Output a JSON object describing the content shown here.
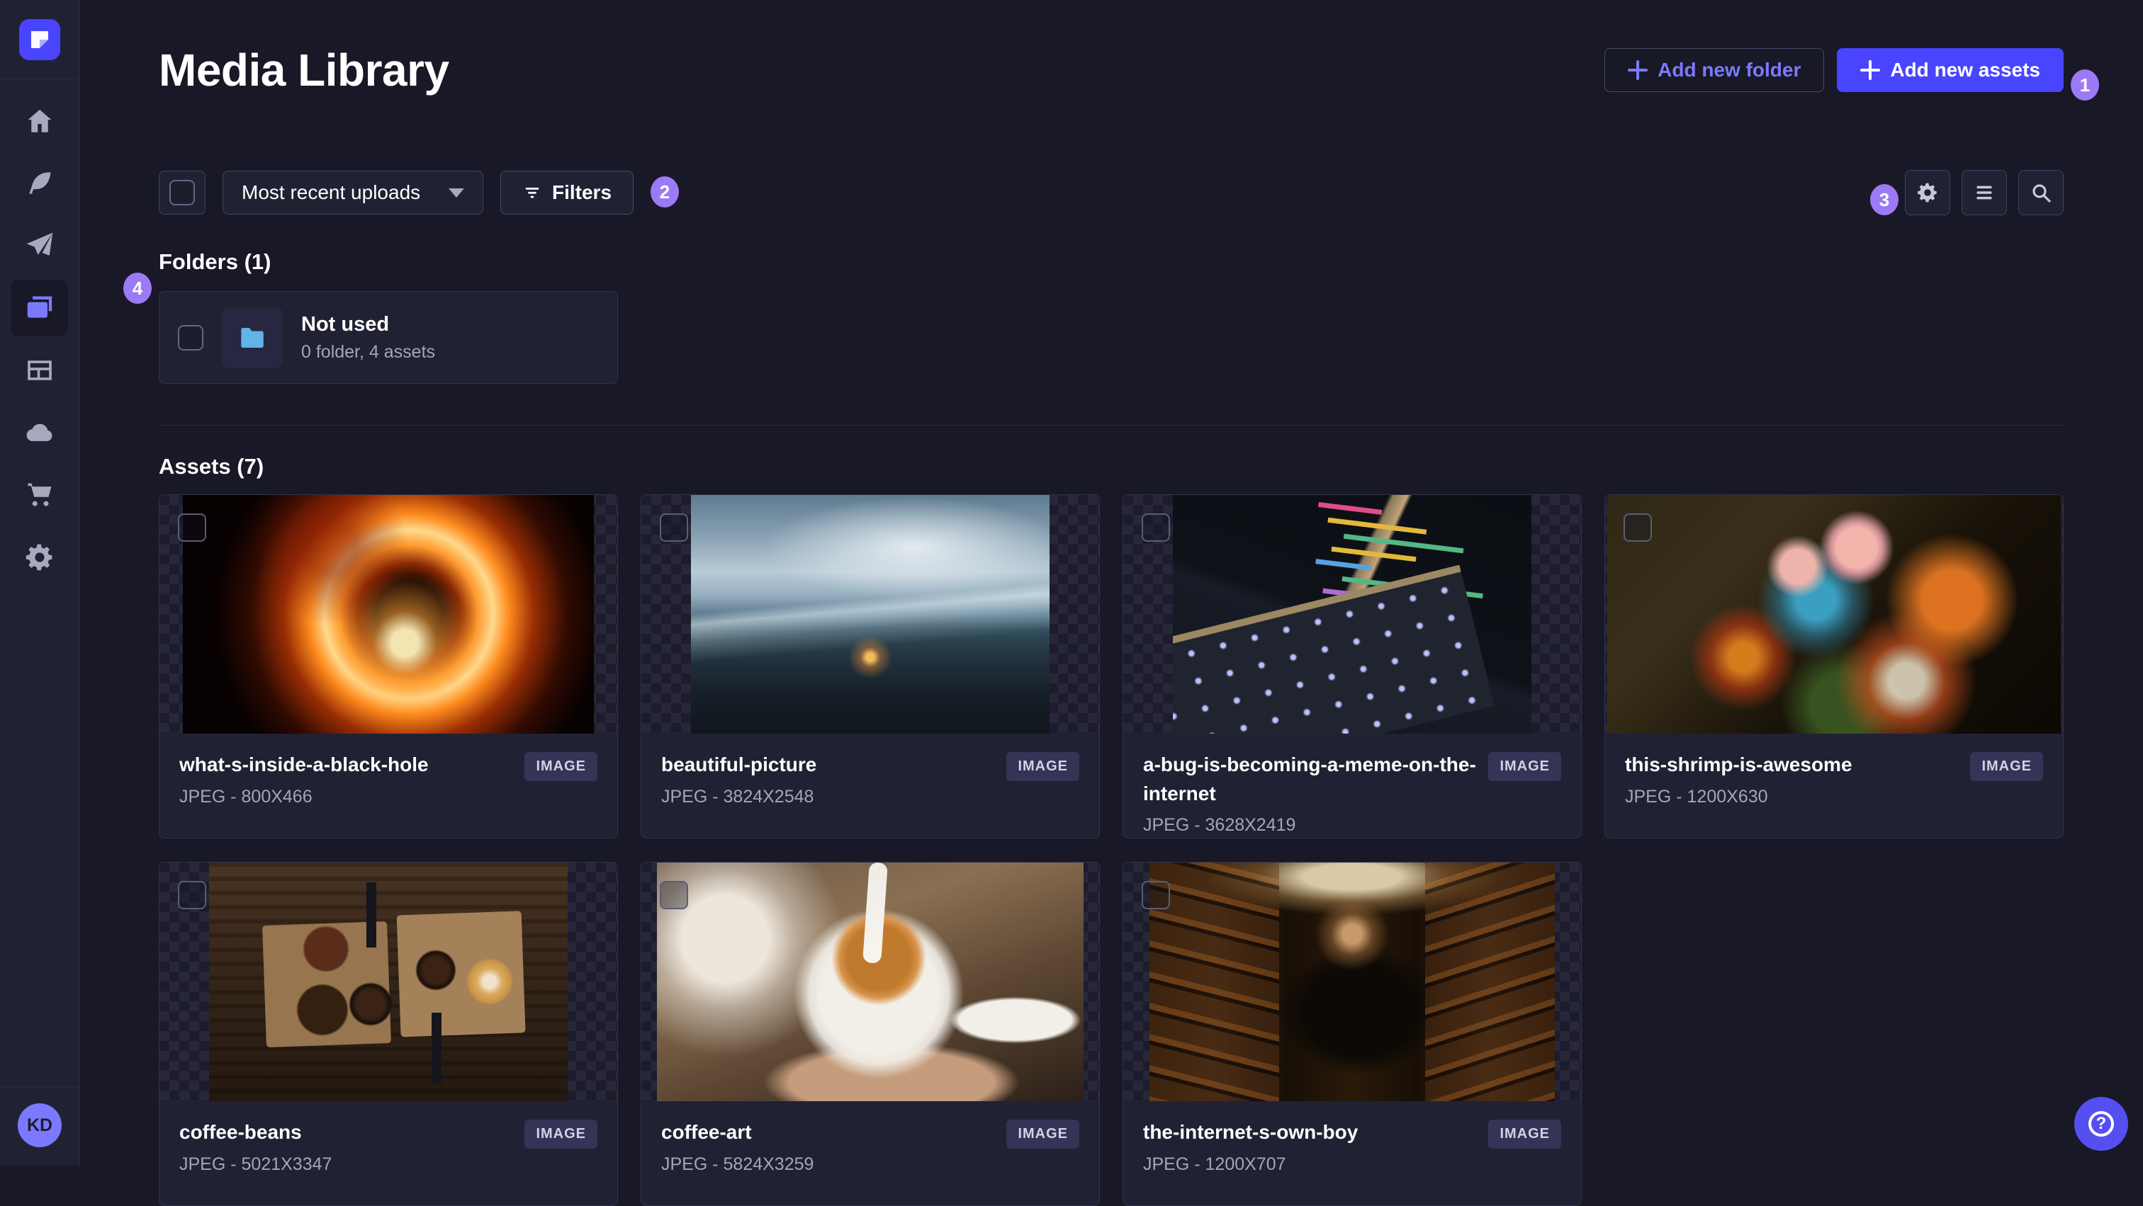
{
  "app": {
    "logo_icon": "strapi-logo-icon"
  },
  "sidebar": {
    "items": [
      {
        "icon": "home-icon"
      },
      {
        "icon": "feather-icon"
      },
      {
        "icon": "paper-plane-icon"
      },
      {
        "icon": "media-library-icon",
        "active": true
      },
      {
        "icon": "layout-icon"
      },
      {
        "icon": "cloud-icon"
      },
      {
        "icon": "cart-icon"
      },
      {
        "icon": "gear-icon"
      }
    ],
    "avatar_initials": "KD"
  },
  "header": {
    "title": "Media Library",
    "add_folder_label": "Add new folder",
    "add_assets_label": "Add new assets"
  },
  "toolbar": {
    "sort_value": "Most recent uploads",
    "filters_label": "Filters",
    "icons": [
      "gear-icon",
      "list-icon",
      "search-icon"
    ]
  },
  "folders_section": {
    "title": "Folders (1)",
    "folders": [
      {
        "name": "Not used",
        "meta": "0 folder, 4 assets",
        "icon": "folder-icon"
      }
    ]
  },
  "assets_section": {
    "title": "Assets (7)",
    "items": [
      {
        "name": "what-s-inside-a-black-hole",
        "meta": "JPEG - 800X466",
        "badge": "IMAGE"
      },
      {
        "name": "beautiful-picture",
        "meta": "JPEG - 3824X2548",
        "badge": "IMAGE"
      },
      {
        "name": "a-bug-is-becoming-a-meme-on-the-internet",
        "meta": "JPEG - 3628X2419",
        "badge": "IMAGE"
      },
      {
        "name": "this-shrimp-is-awesome",
        "meta": "JPEG - 1200X630",
        "badge": "IMAGE"
      },
      {
        "name": "coffee-beans",
        "meta": "JPEG - 5021X3347",
        "badge": "IMAGE"
      },
      {
        "name": "coffee-art",
        "meta": "JPEG - 5824X3259",
        "badge": "IMAGE"
      },
      {
        "name": "the-internet-s-own-boy",
        "meta": "JPEG - 1200X707",
        "badge": "IMAGE"
      }
    ]
  },
  "annotations": {
    "badge1": "1",
    "badge2": "2",
    "badge3": "3",
    "badge4": "4"
  },
  "help": {
    "label": "?"
  },
  "colors": {
    "primary": "#4945ff",
    "primary_light": "#7b79ff",
    "background": "#181826",
    "surface": "#212134",
    "border": "#32324d",
    "text_secondary": "#a5a5ba",
    "annotation_purple": "#9c7af5",
    "folder_blue": "#61b3e8",
    "avatar_purple": "#7b79ff"
  }
}
